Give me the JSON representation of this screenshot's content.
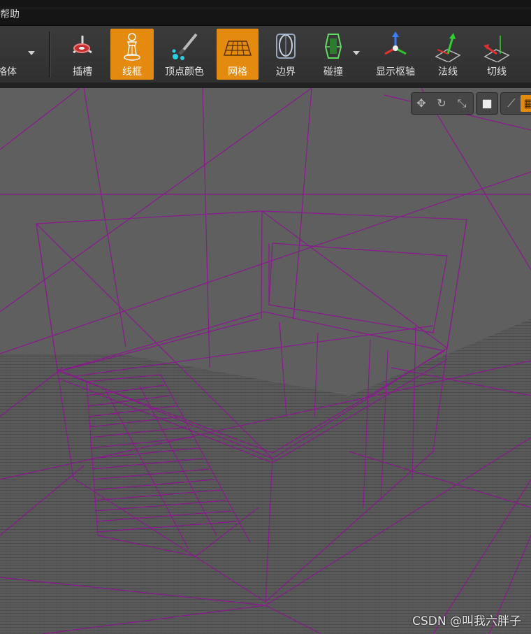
{
  "menu": {
    "help_fragment": "帮助"
  },
  "toolbar": {
    "left_fragment": "格体",
    "items": [
      {
        "label": "插槽",
        "icon": "socket-icon",
        "active": false
      },
      {
        "label": "线框",
        "icon": "wireframe-pawn-icon",
        "active": true
      },
      {
        "label": "顶点颜色",
        "icon": "vertex-color-brush-icon",
        "active": false
      },
      {
        "label": "网格",
        "icon": "grid-icon",
        "active": true
      },
      {
        "label": "边界",
        "icon": "bounds-icon",
        "active": false
      },
      {
        "label": "碰撞",
        "icon": "collision-icon",
        "active": false
      },
      {
        "label": "显示枢轴",
        "icon": "pivot-axes-icon",
        "active": false
      },
      {
        "label": "法线",
        "icon": "normals-icon",
        "active": false
      },
      {
        "label": "切线",
        "icon": "tangents-icon",
        "active": false
      }
    ],
    "colors": {
      "active": "#e48a0f",
      "bg": "#353535"
    }
  },
  "viewport": {
    "background": "#5e5e5e",
    "wire_color": "#8a1a8e",
    "controls": [
      "translate-icon",
      "rotate-icon",
      "scale-icon",
      "perspective-cube-icon",
      "surface-snap-icon",
      "grid-snap-icon"
    ]
  },
  "watermark": "CSDN @叫我六胖子"
}
